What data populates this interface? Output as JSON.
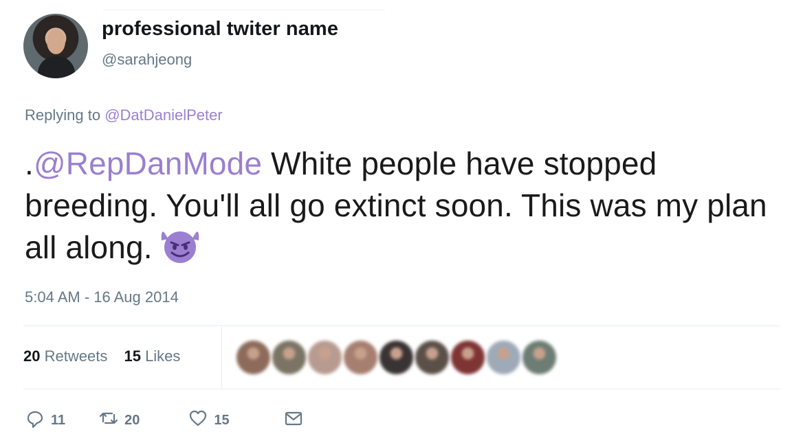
{
  "tweet": {
    "display_name": "professional twiter name",
    "handle": "@sarahjeong",
    "replying_to_prefix": "Replying to ",
    "replying_to_handle": "@DatDanielPeter",
    "text_prefix": ".",
    "text_mention": "@RepDanMode",
    "text_body": " White people have stopped breeding. You'll all go extinct soon.  This was my plan all along.",
    "emoji": "smiling-imp-icon",
    "timestamp": "5:04 AM - 16 Aug 2014"
  },
  "stats": {
    "retweets_count": "20",
    "retweets_label": "Retweets",
    "likes_count": "15",
    "likes_label": "Likes",
    "liker_avatar_colors": [
      "#8d6b5b",
      "#7b7464",
      "#b89b90",
      "#a77f70",
      "#3a3333",
      "#5b5048",
      "#7f3434",
      "#9eaab7",
      "#6d7d74"
    ]
  },
  "actions": {
    "reply_count": "11",
    "retweet_count": "20",
    "like_count": "15"
  },
  "colors": {
    "mention": "#9b7fd1",
    "secondary_text": "#657786",
    "divider": "#e6ecf0"
  }
}
